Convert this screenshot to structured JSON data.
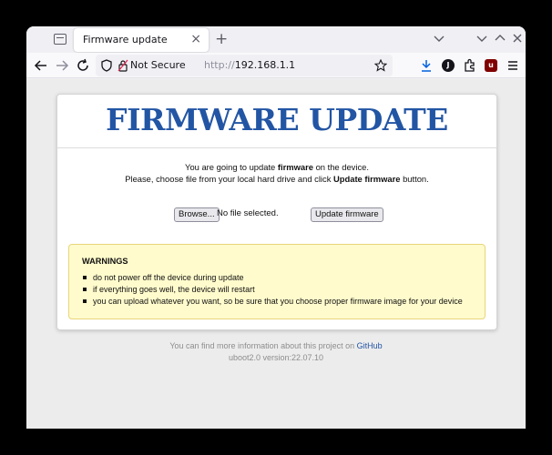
{
  "browser": {
    "tab_title": "Firmware update",
    "tab_close": "×",
    "new_tab": "+",
    "security_label": "Not Secure",
    "url_scheme": "http://",
    "url_host": "192.168.1.1",
    "profile_initial": "J",
    "ublock_count": "u",
    "accent": "#0060df"
  },
  "page": {
    "title": "FIRMWARE UPDATE",
    "intro_line1_pre": "You are going to update ",
    "intro_line1_bold": "firmware",
    "intro_line1_post": " on the device.",
    "intro_line2_pre": "Please, choose file from your local hard drive and click ",
    "intro_line2_bold": "Update firmware",
    "intro_line2_post": " button.",
    "browse_label": "Browse...",
    "no_file_label": "No file selected.",
    "update_label": "Update firmware",
    "title_color": "#2255a4"
  },
  "warnings": {
    "title": "WARNINGS",
    "items": [
      "do not power off the device during update",
      "if everything goes well, the device will restart",
      "you can upload whatever you want, so be sure that you choose proper firmware image for your device"
    ],
    "background": "#fffbcc"
  },
  "footer": {
    "info_pre": "You can find more information about this project on ",
    "link_text": "GitHub",
    "version": "uboot2.0 version:22.07.10"
  }
}
